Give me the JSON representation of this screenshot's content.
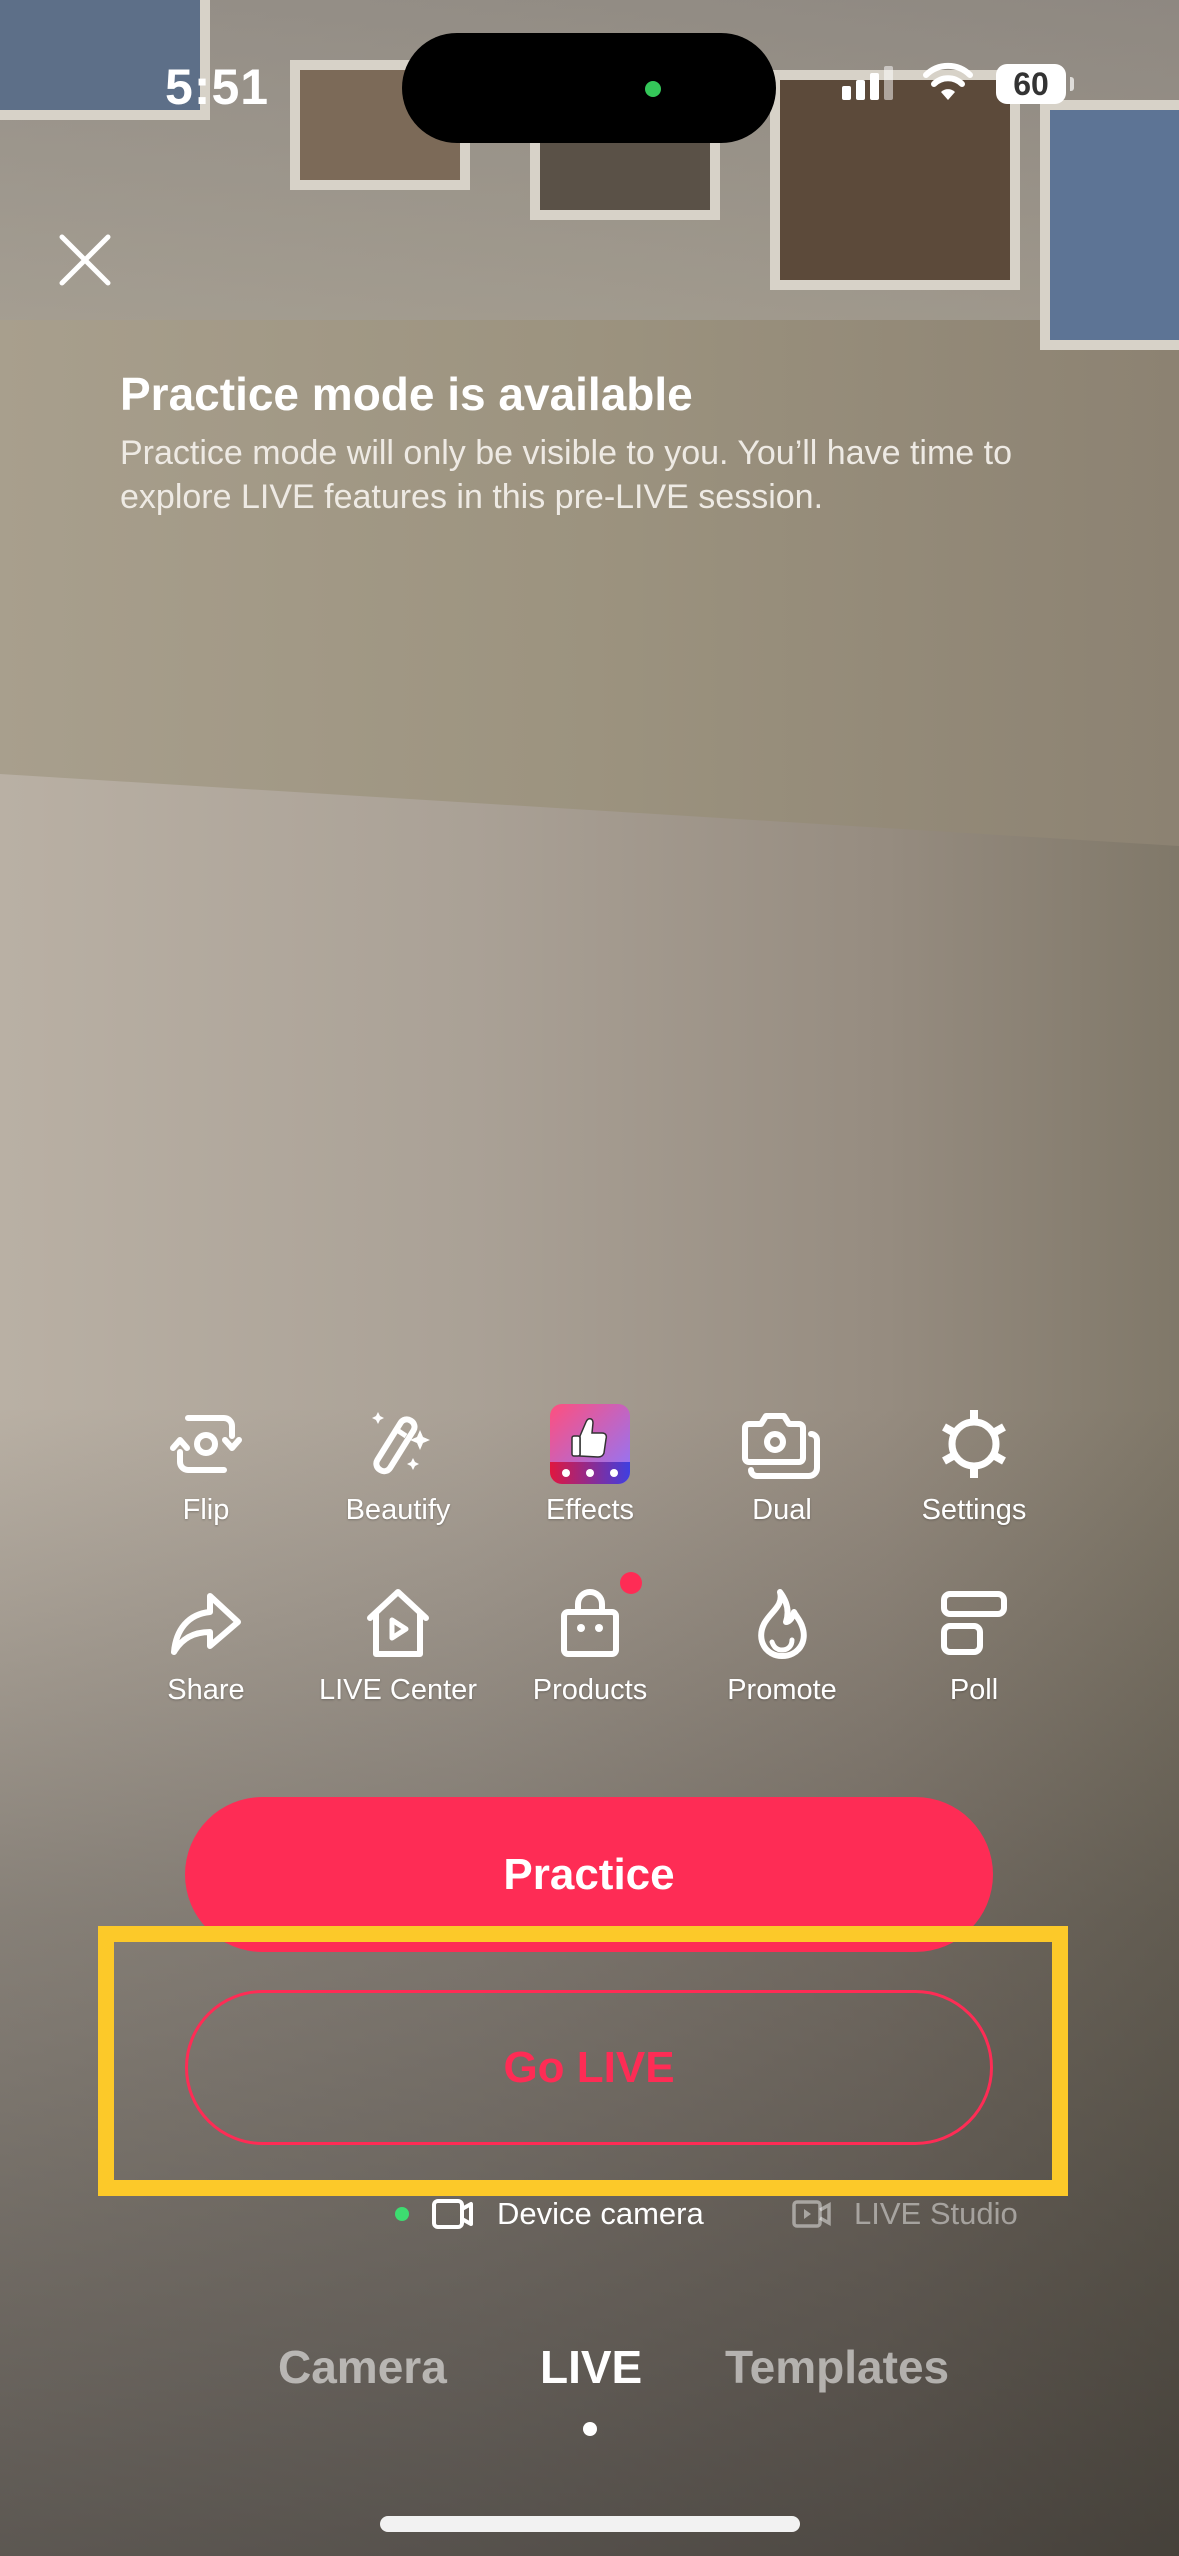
{
  "status_bar": {
    "time": "5:51",
    "battery": "60",
    "icons": [
      "cellular-signal-icon",
      "wifi-icon",
      "battery-icon"
    ],
    "camera_indicator_color": "#34c759"
  },
  "close_icon": "close-icon",
  "info": {
    "title": "Practice mode is available",
    "body": "Practice mode will only be visible to you. You’ll have time to explore LIVE features in this pre-LIVE session."
  },
  "tools": {
    "row1": [
      {
        "label": "Flip",
        "icon": "flip-camera-icon"
      },
      {
        "label": "Beautify",
        "icon": "magic-wand-icon"
      },
      {
        "label": "Effects",
        "icon": "effects-thumbs-up-icon"
      },
      {
        "label": "Dual",
        "icon": "dual-camera-icon"
      },
      {
        "label": "Settings",
        "icon": "gear-icon"
      }
    ],
    "row2": [
      {
        "label": "Share",
        "icon": "share-arrow-icon"
      },
      {
        "label": "LIVE Center",
        "icon": "live-center-house-icon"
      },
      {
        "label": "Products",
        "icon": "shopping-bag-icon",
        "badge": true
      },
      {
        "label": "Promote",
        "icon": "flame-icon"
      },
      {
        "label": "Poll",
        "icon": "poll-icon"
      }
    ]
  },
  "buttons": {
    "practice": "Practice",
    "go_live": "Go LIVE"
  },
  "source": {
    "device": "Device camera",
    "studio": "LIVE Studio",
    "selected": "Device camera"
  },
  "modes": {
    "items": [
      "Camera",
      "LIVE",
      "Templates"
    ],
    "active": "LIVE"
  },
  "colors": {
    "accent": "#fe2c55",
    "highlight": "#fcc929",
    "active_dot": "#3ddc70"
  }
}
